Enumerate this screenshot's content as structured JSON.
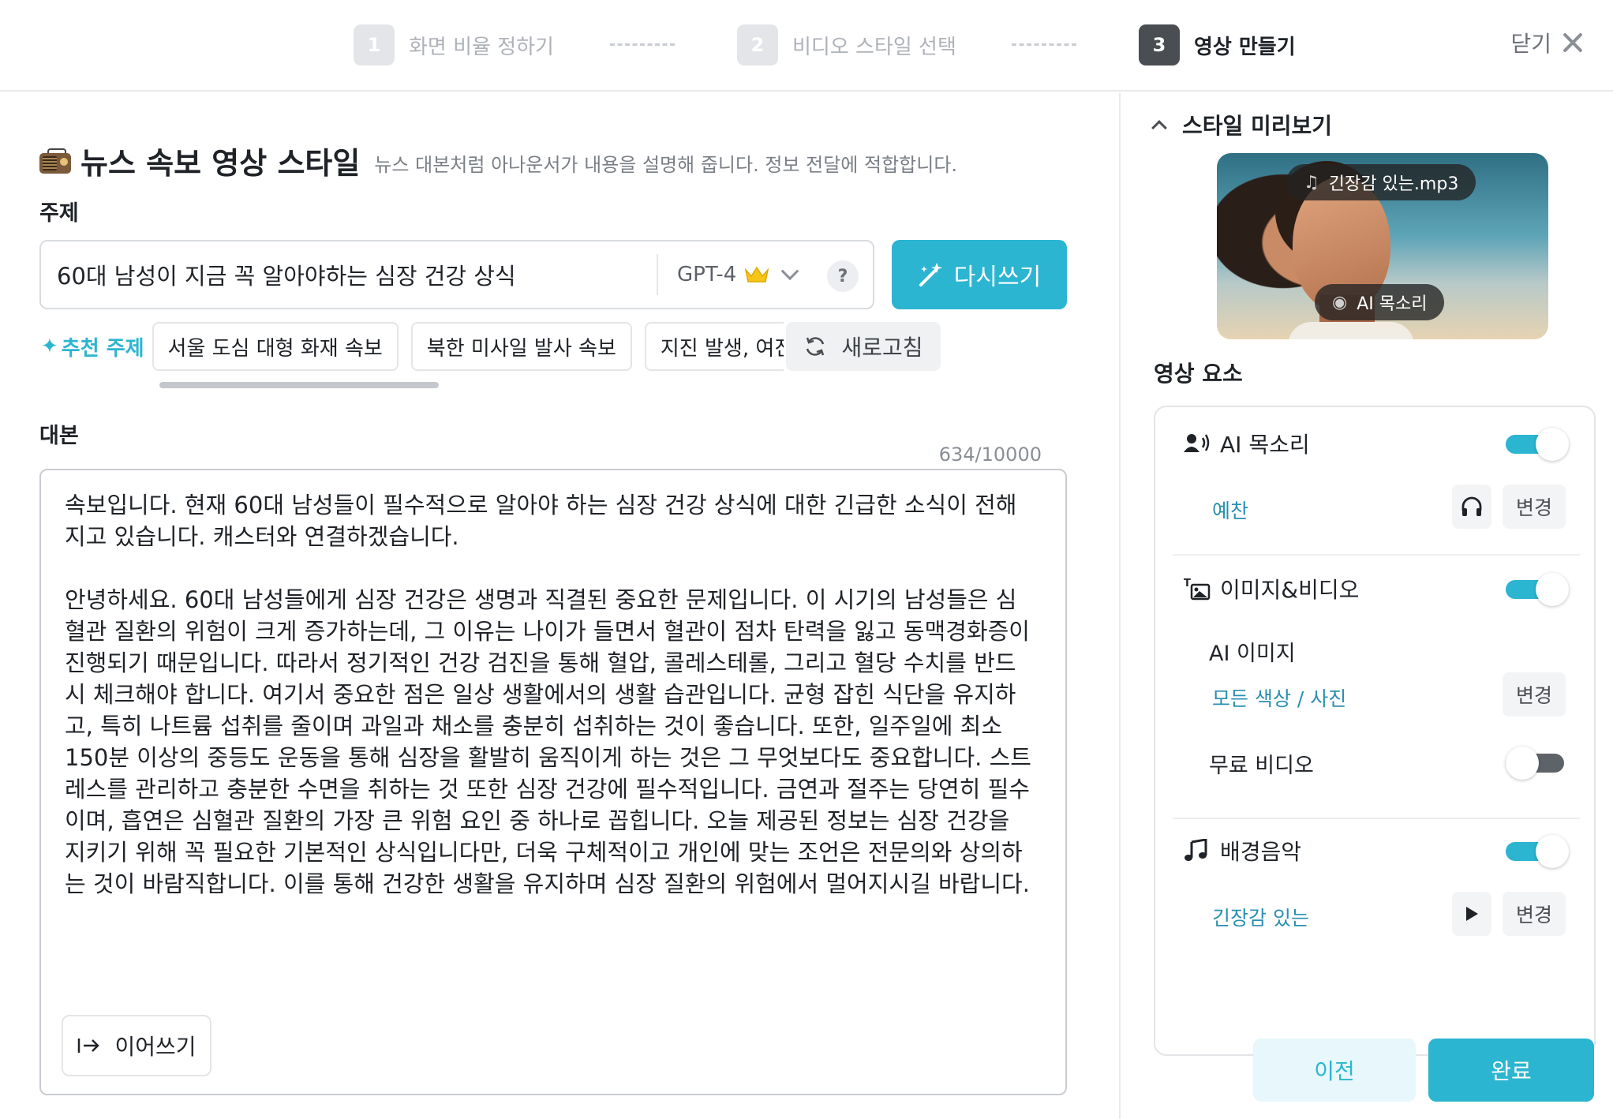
{
  "stepper": {
    "steps": [
      {
        "num": "1",
        "label": "화면 비율 정하기"
      },
      {
        "num": "2",
        "label": "비디오 스타일 선택"
      },
      {
        "num": "3",
        "label": "영상 만들기"
      }
    ],
    "close_label": "닫기"
  },
  "style": {
    "icon": "radio-icon",
    "title": "뉴스 속보 영상 스타일",
    "description": "뉴스 대본처럼 아나운서가 내용을 설명해 줍니다. 정보 전달에 적합합니다."
  },
  "topic": {
    "label": "주제",
    "value": "60대 남성이 지금 꼭 알아야하는 심장 건강 상식",
    "model": "GPT-4",
    "help": "?",
    "rewrite_label": "다시쓰기"
  },
  "suggestions": {
    "label": "추천 주제",
    "chips": [
      "서울 도심 대형 화재 속보",
      "북한 미사일 발사 속보",
      "지진 발생, 여진 경고"
    ],
    "refresh_label": "새로고침"
  },
  "script": {
    "label": "대본",
    "count": "634/10000",
    "text": "속보입니다. 현재 60대 남성들이 필수적으로 알아야 하는 심장 건강 상식에 대한 긴급한 소식이 전해\n지고 있습니다. 캐스터와 연결하겠습니다.\n\n안녕하세요. 60대 남성들에게 심장 건강은 생명과 직결된 중요한 문제입니다. 이 시기의 남성들은 심\n혈관 질환의 위험이 크게 증가하는데, 그 이유는 나이가 들면서 혈관이 점차 탄력을 잃고 동맥경화증이\n진행되기 때문입니다. 따라서 정기적인 건강 검진을 통해 혈압, 콜레스테롤, 그리고 혈당 수치를 반드\n시 체크해야 합니다. 여기서 중요한 점은 일상 생활에서의 생활 습관입니다. 균형 잡힌 식단을 유지하\n고, 특히 나트륨 섭취를 줄이며 과일과 채소를 충분히 섭취하는 것이 좋습니다. 또한, 일주일에 최소\n150분 이상의 중등도 운동을 통해 심장을 활발히 움직이게 하는 것은 그 무엇보다도 중요합니다. 스트\n레스를 관리하고 충분한 수면을 취하는 것 또한 심장 건강에 필수적입니다. 금연과 절주는 당연히 필수\n이며, 흡연은 심혈관 질환의 가장 큰 위험 요인 중 하나로 꼽힙니다. 오늘 제공된 정보는 심장 건강을\n지키기 위해 꼭 필요한 기본적인 상식입니다만, 더욱 구체적이고 개인에 맞는 조언은 전문의와 상의하\n는 것이 바람직합니다. 이를 통해 건강한 생활을 유지하며 심장 질환의 위험에서 멀어지시길 바랍니다.",
    "continue_label": "이어쓰기"
  },
  "preview": {
    "title": "스타일 미리보기",
    "music_pill": "긴장감 있는.mp3",
    "voice_pill": "AI 목소리"
  },
  "elements": {
    "label": "영상 요소",
    "voice": {
      "title": "AI 목소리",
      "enabled": true,
      "value": "예찬",
      "change": "변경"
    },
    "media": {
      "title": "이미지&비디오",
      "enabled": true,
      "ai_image_label": "AI 이미지",
      "ai_image_value": "모든 색상 / 사진",
      "change": "변경",
      "free_video_label": "무료 비디오",
      "free_video_enabled": false
    },
    "music": {
      "title": "배경음악",
      "enabled": true,
      "value": "긴장감 있는",
      "change": "변경"
    }
  },
  "footer": {
    "prev_label": "이전",
    "done_label": "완료"
  },
  "colors": {
    "accent": "#2cb5d1",
    "link": "#2a8fb0",
    "toggle_off": "#5e6369"
  }
}
